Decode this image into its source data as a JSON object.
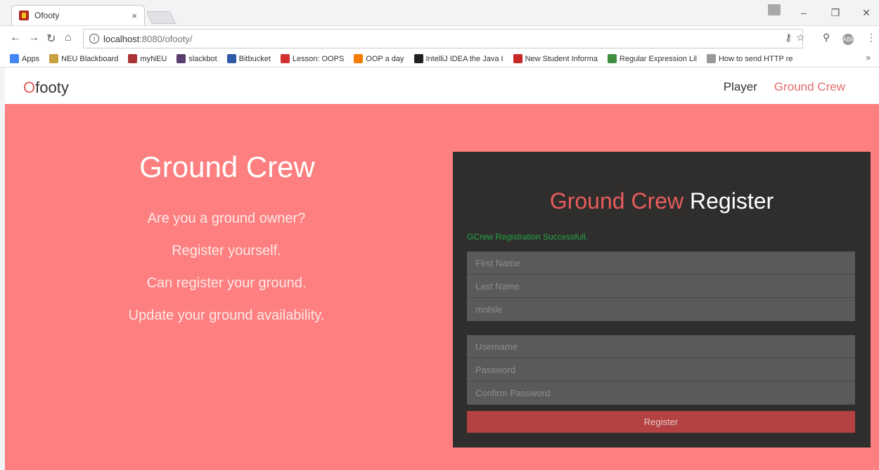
{
  "browser": {
    "tab_title": "Ofooty",
    "tab_close": "×",
    "url_host": "localhost",
    "url_path": ":8080/ofooty/",
    "bookmarks": [
      {
        "label": "Apps",
        "color": "#4285f4"
      },
      {
        "label": "NEU Blackboard",
        "color": "#c8a13d"
      },
      {
        "label": "myNEU",
        "color": "#a33"
      },
      {
        "label": "slackbot",
        "color": "#5a3d6e"
      },
      {
        "label": "Bitbucket",
        "color": "#2f5aa8"
      },
      {
        "label": "Lesson: OOPS",
        "color": "#d32f2f"
      },
      {
        "label": "OOP a day",
        "color": "#f57c00"
      },
      {
        "label": "IntelliJ IDEA the Java I",
        "color": "#222"
      },
      {
        "label": "New Student Informa",
        "color": "#c62828"
      },
      {
        "label": "Regular Expression Lil",
        "color": "#3e8e41"
      },
      {
        "label": "How to send HTTP re",
        "color": "#999"
      }
    ],
    "more": "»"
  },
  "site": {
    "brand_o": "O",
    "brand_rest": "footy",
    "nav": [
      "Player",
      "Ground Crew"
    ]
  },
  "hero": {
    "title": "Ground Crew",
    "lines": [
      "Are you a ground owner?",
      "Register yourself.",
      "Can register your ground.",
      "Update your ground availability."
    ]
  },
  "panel": {
    "title_a": "Ground Crew",
    "title_b": "Register",
    "message": "GCrew Registration Successfull.",
    "group1": [
      "First Name",
      "Last Name",
      "mobile"
    ],
    "group2": [
      "Username",
      "Password",
      "Confirm Password"
    ],
    "button": "Register"
  }
}
